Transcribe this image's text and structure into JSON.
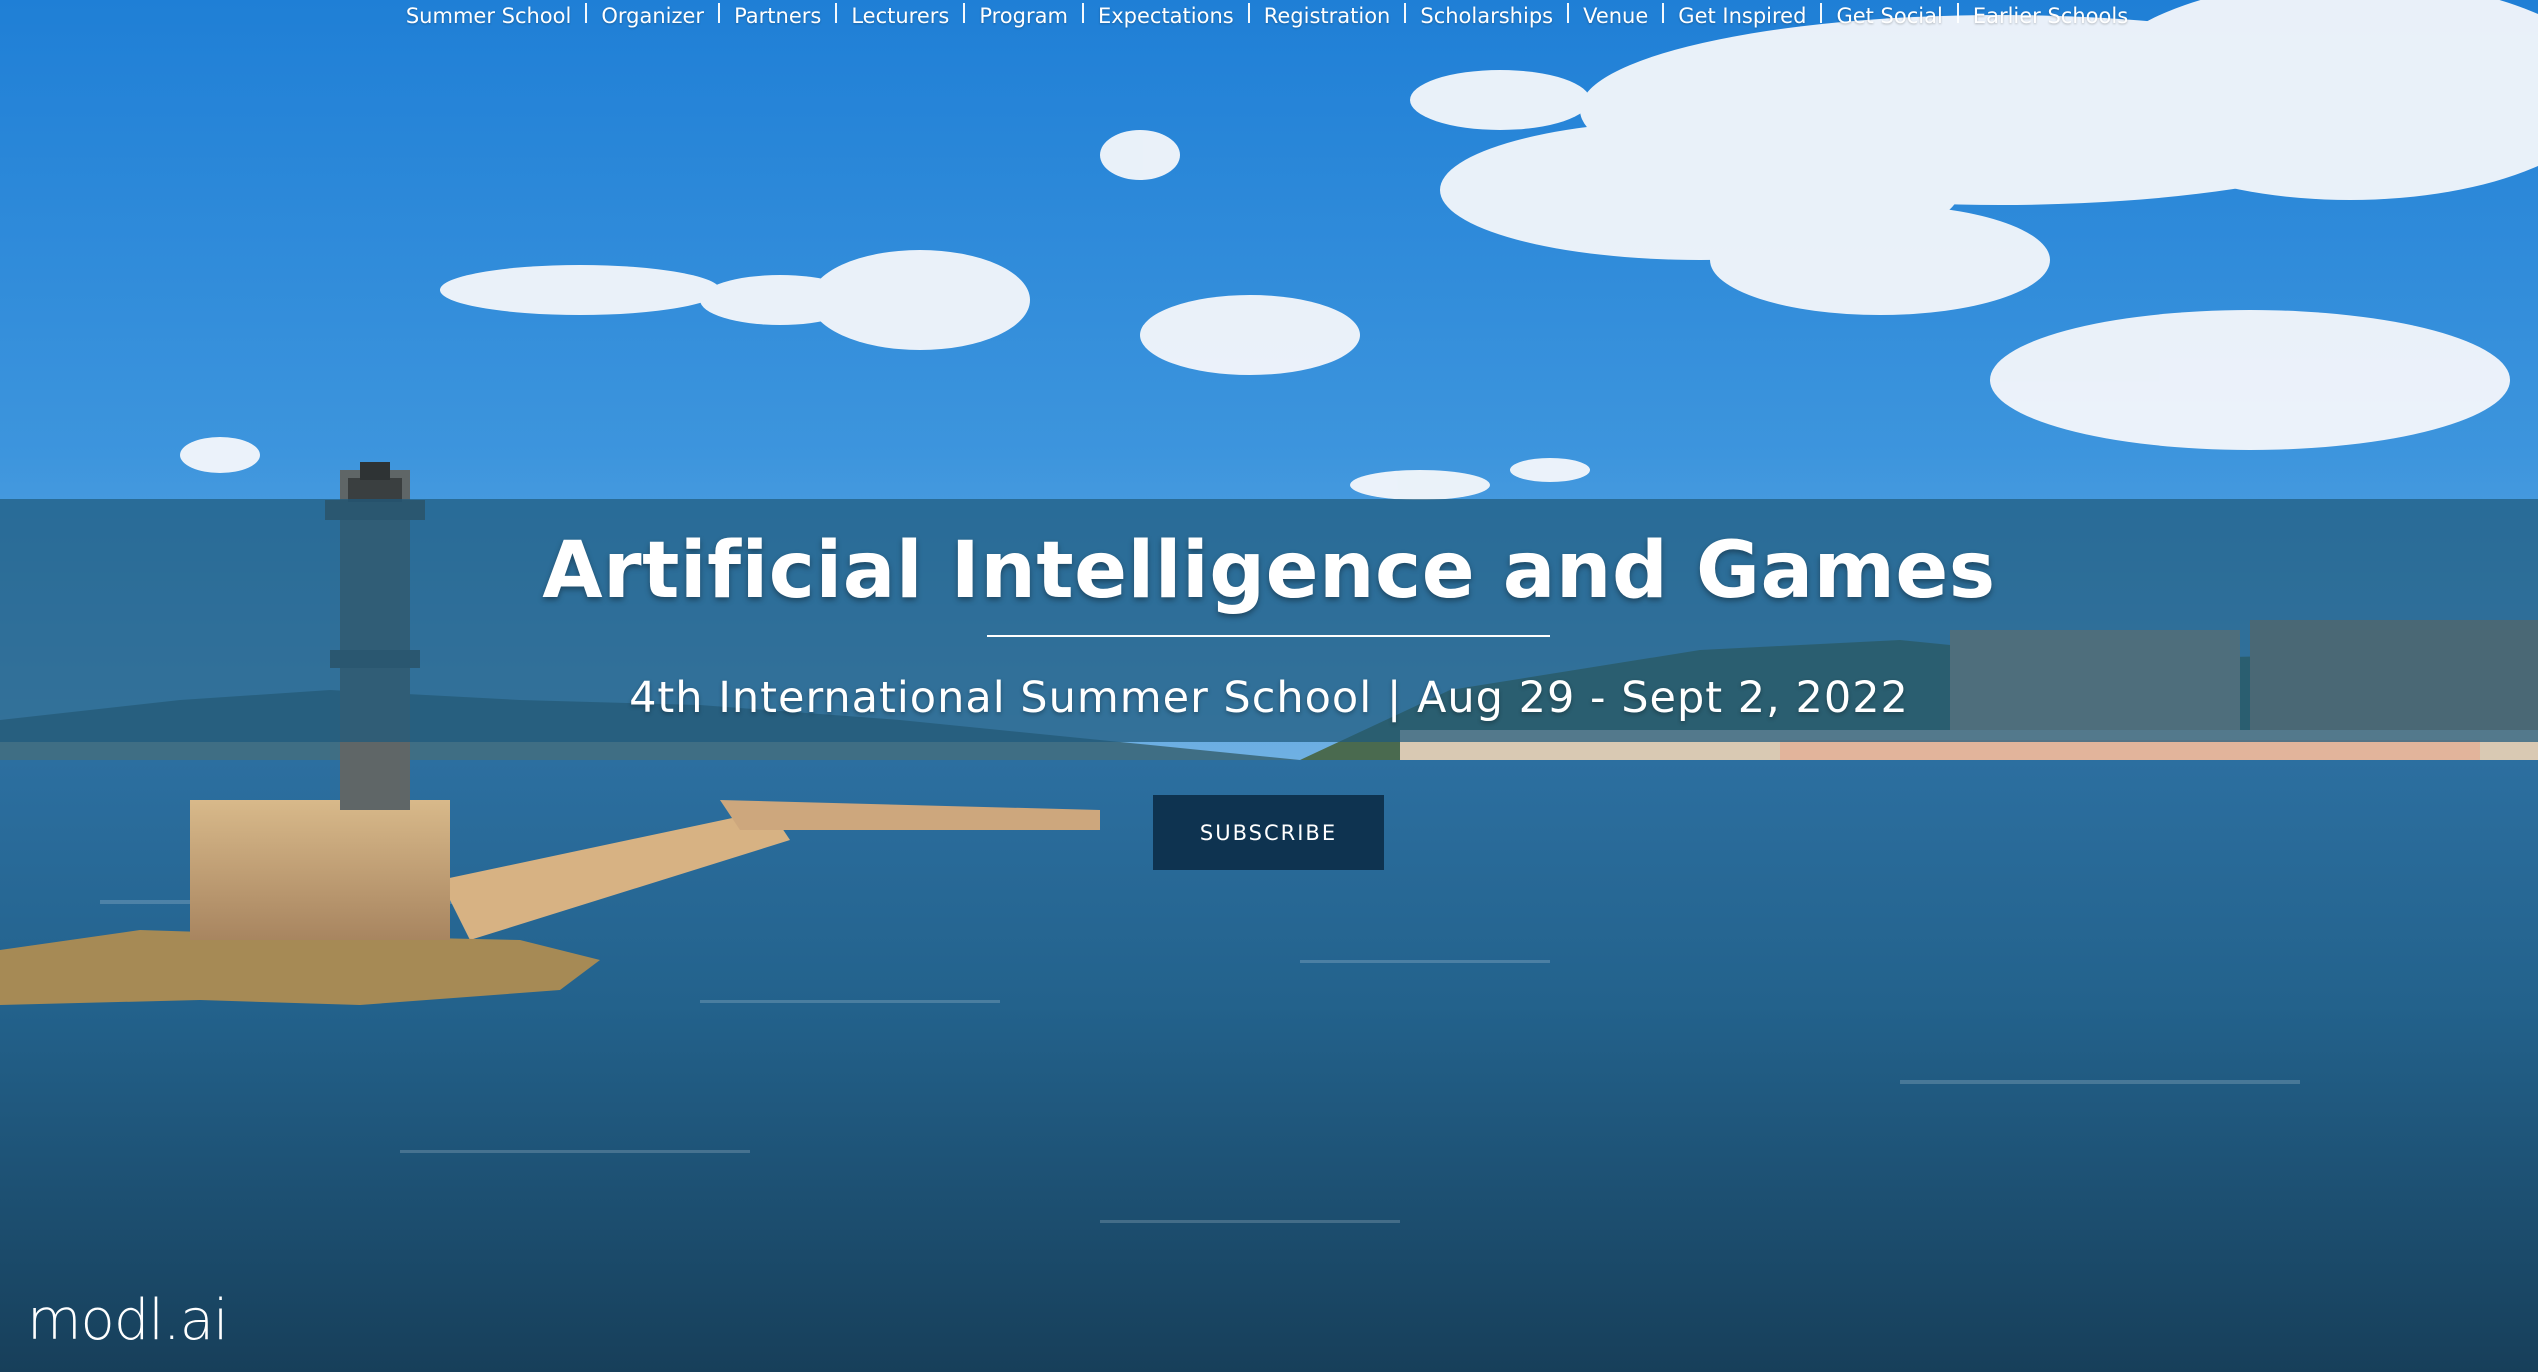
{
  "nav": {
    "items": [
      {
        "label": "Summer School"
      },
      {
        "label": "Organizer"
      },
      {
        "label": "Partners"
      },
      {
        "label": "Lecturers"
      },
      {
        "label": "Program"
      },
      {
        "label": "Expectations"
      },
      {
        "label": "Registration"
      },
      {
        "label": "Scholarships"
      },
      {
        "label": "Venue"
      },
      {
        "label": "Get Inspired"
      },
      {
        "label": "Get Social"
      },
      {
        "label": "Earlier Schools"
      }
    ]
  },
  "hero": {
    "title": "Artificial Intelligence and Games",
    "subtitle": "4th International Summer School | Aug 29 - Sept 2, 2022",
    "subscribe_label": "SUBSCRIBE",
    "background_image": "harbor-lighthouse-photo"
  },
  "footer": {
    "logo_text": "modl.ai"
  },
  "colors": {
    "band": "#1e5a7d",
    "button": "#0e3350",
    "text": "#ffffff"
  }
}
